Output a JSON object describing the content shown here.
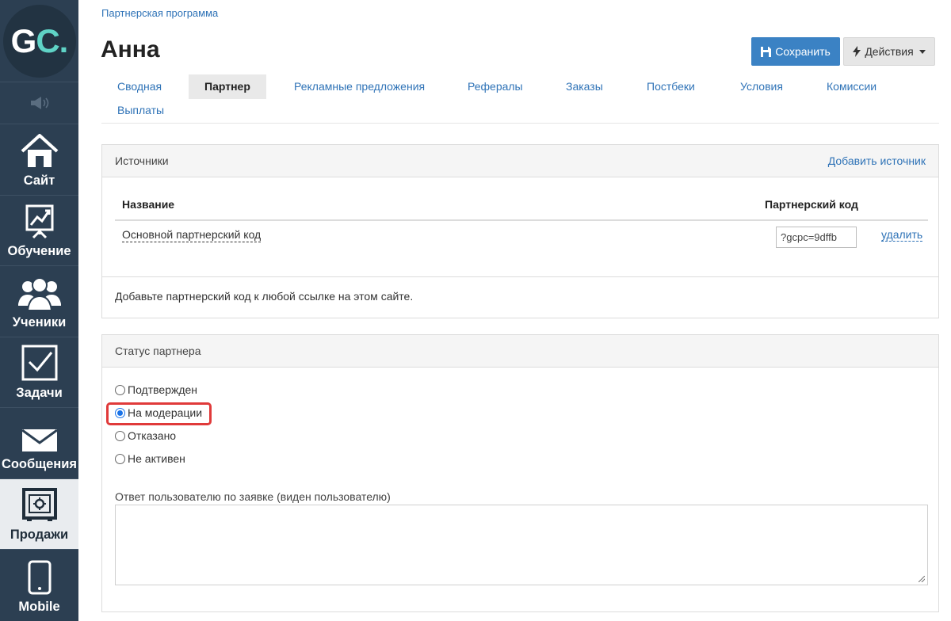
{
  "sidebar": {
    "logo": {
      "left": "G",
      "right": "C."
    },
    "sound_icon": "speaker-icon",
    "items": [
      {
        "label": "Сайт",
        "icon": "home-icon"
      },
      {
        "label": "Обучение",
        "icon": "chart-board-icon"
      },
      {
        "label": "Ученики",
        "icon": "users-icon"
      },
      {
        "label": "Задачи",
        "icon": "checkbox-icon"
      },
      {
        "label": "Сообщения",
        "icon": "envelope-icon"
      },
      {
        "label": "Продажи",
        "icon": "safe-icon",
        "active": true
      },
      {
        "label": "Mobile",
        "icon": "phone-icon"
      }
    ]
  },
  "header": {
    "breadcrumb": "Партнерская программа",
    "title": "Анна",
    "save_label": "Сохранить",
    "actions_label": "Действия"
  },
  "tabs": [
    {
      "label": "Сводная"
    },
    {
      "label": "Партнер",
      "active": true
    },
    {
      "label": "Рекламные предложения"
    },
    {
      "label": "Рефералы"
    },
    {
      "label": "Заказы"
    },
    {
      "label": "Постбеки"
    },
    {
      "label": "Условия"
    },
    {
      "label": "Комиссии"
    },
    {
      "label": "Выплаты"
    }
  ],
  "sources": {
    "title": "Источники",
    "add_link": "Добавить источник",
    "columns": [
      "Название",
      "Партнерский код"
    ],
    "rows": [
      {
        "name": "Основной партнерский код",
        "code": "?gcpc=9dffb",
        "delete_label": "удалить"
      }
    ],
    "footer": "Добавьте партнерский код к любой ссылке на этом сайте."
  },
  "status": {
    "title": "Статус партнера",
    "options": [
      {
        "label": "Подтвержден",
        "checked": false
      },
      {
        "label": "На модерации",
        "checked": true
      },
      {
        "label": "Отказано",
        "checked": false
      },
      {
        "label": "Не активен",
        "checked": false
      }
    ],
    "reply_label": "Ответ пользователю по заявке (виден пользователю)",
    "reply_value": ""
  },
  "colors": {
    "sidebar_bg": "#2c3f52",
    "primary": "#3b82c4",
    "link": "#2f73b7",
    "highlight": "#e03a3a",
    "logo_accent": "#5fd3c6"
  }
}
